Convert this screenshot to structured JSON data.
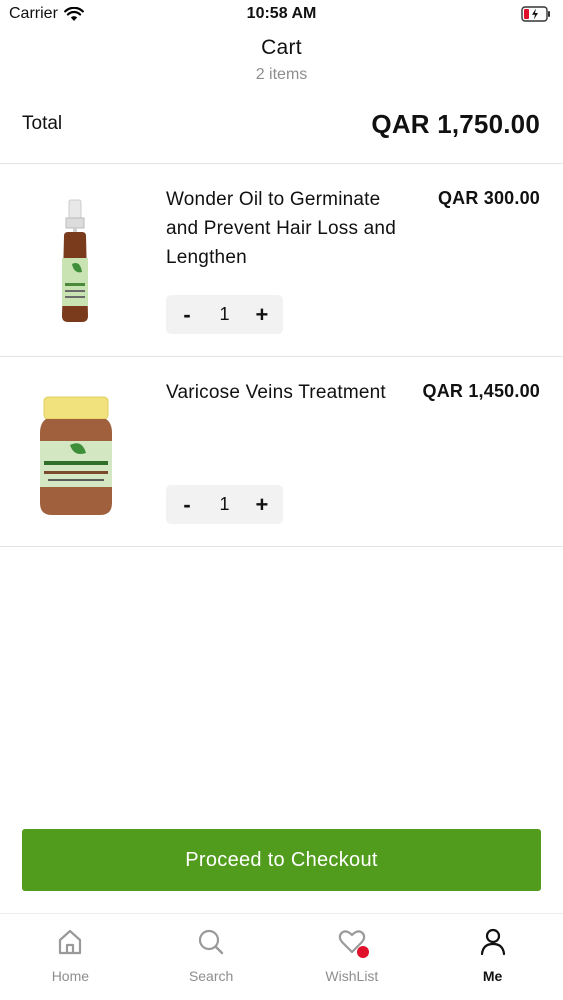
{
  "status_bar": {
    "carrier": "Carrier",
    "time": "10:58 AM"
  },
  "header": {
    "title": "Cart",
    "subtitle": "2 items"
  },
  "total": {
    "label": "Total",
    "value": "QAR 1,750.00"
  },
  "items": [
    {
      "name": "Wonder Oil to Germinate and Prevent Hair Loss and Lengthen",
      "price": "QAR 300.00",
      "quantity": "1",
      "image_icon": "spray-bottle-image"
    },
    {
      "name": "Varicose Veins Treatment",
      "price": "QAR 1,450.00",
      "quantity": "1",
      "image_icon": "jar-image"
    }
  ],
  "stepper": {
    "minus": "-",
    "plus": "+"
  },
  "checkout": {
    "label": "Proceed to Checkout",
    "color": "#519c1d"
  },
  "tabbar": {
    "tabs": [
      {
        "label": "Home",
        "icon": "home-icon",
        "active": false
      },
      {
        "label": "Search",
        "icon": "search-icon",
        "active": false
      },
      {
        "label": "WishList",
        "icon": "heart-icon",
        "active": false
      },
      {
        "label": "Me",
        "icon": "user-icon",
        "active": true
      }
    ],
    "badge_color": "#e0102a"
  }
}
